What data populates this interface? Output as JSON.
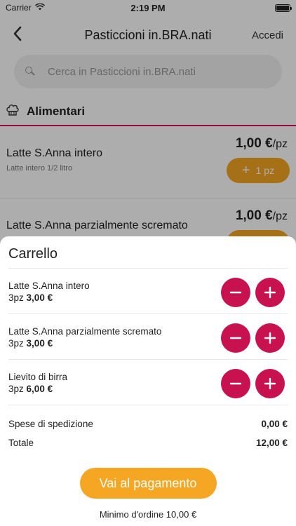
{
  "status": {
    "carrier": "Carrier",
    "time": "2:19 PM"
  },
  "nav": {
    "title": "Pasticcioni in.BRA.nati",
    "login": "Accedi"
  },
  "search": {
    "placeholder": "Cerca in Pasticcioni in.BRA.nati"
  },
  "category": {
    "label": "Alimentari",
    "icon": "chef-hat-icon"
  },
  "products": [
    {
      "name": "Latte S.Anna intero",
      "desc": "Latte intero 1/2 litro",
      "price": "1,00 €",
      "unit": "/pz",
      "add_qty": "1 pz"
    },
    {
      "name": "Latte S.Anna parzialmente scremato",
      "desc": "",
      "price": "1,00 €",
      "unit": "/pz",
      "add_qty": ""
    }
  ],
  "cart": {
    "title": "Carrello",
    "items": [
      {
        "name": "Latte S.Anna intero",
        "qty": "3pz",
        "price": "3,00 €"
      },
      {
        "name": "Latte S.Anna parzialmente scremato",
        "qty": "3pz",
        "price": "3,00 €"
      },
      {
        "name": "Lievito di birra",
        "qty": "3pz",
        "price": "6,00 €"
      }
    ],
    "shipping_label": "Spese di spedizione",
    "shipping_value": "0,00 €",
    "total_label": "Totale",
    "total_value": "12,00 €",
    "pay_label": "Vai al pagamento",
    "min_order": "Minimo d'ordine 10,00 €"
  },
  "colors": {
    "accent": "#f5a623",
    "primary": "#c8124f",
    "category_line": "#d4145a"
  }
}
